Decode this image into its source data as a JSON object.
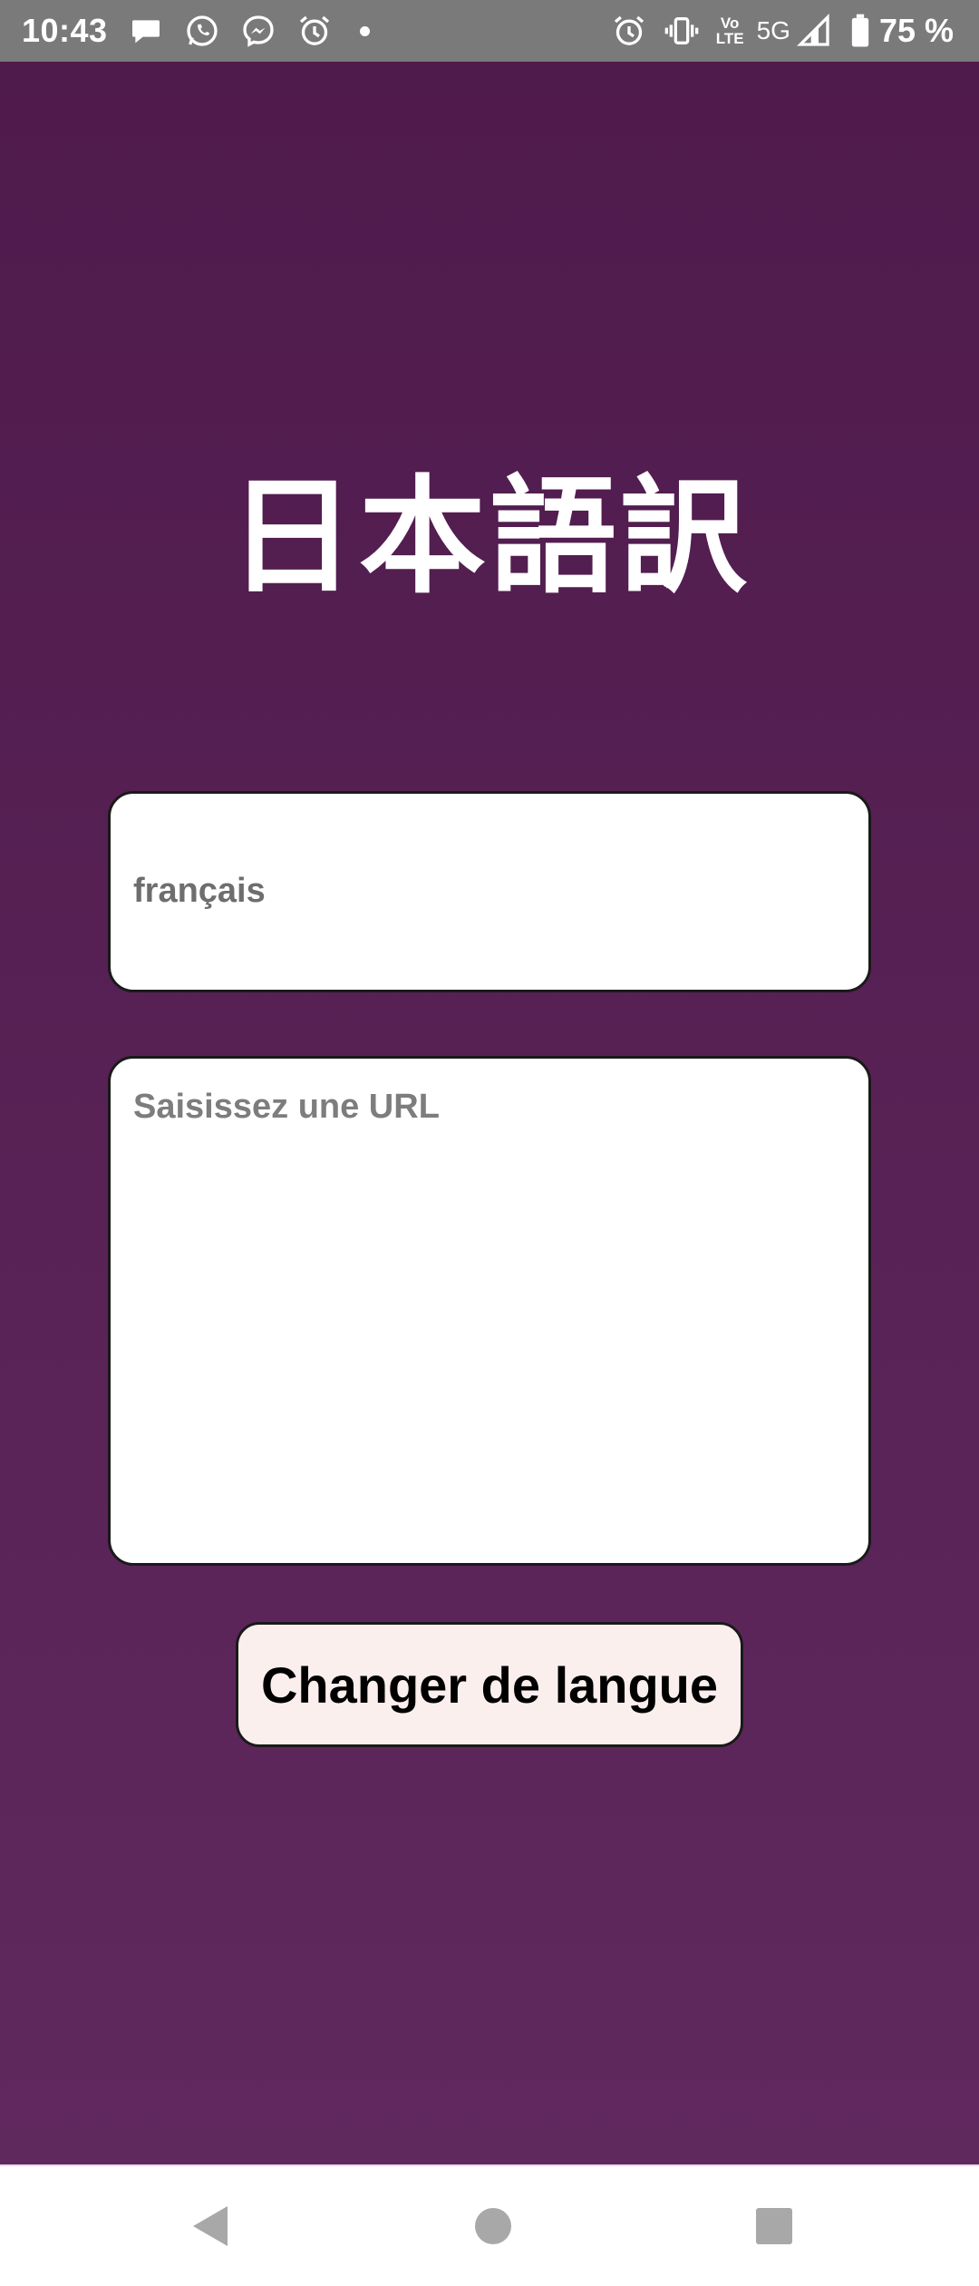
{
  "status_bar": {
    "time": "10:43",
    "left_icons": [
      "chat-bubble-icon",
      "whatsapp-icon",
      "messenger-icon",
      "alarm-clock-icon",
      "dot-icon"
    ],
    "right_icons": [
      "alarm-clock-icon",
      "vibrate-icon",
      "volte-icon",
      "5g-icon",
      "signal-icon",
      "battery-icon"
    ],
    "volte_top": "Vo",
    "volte_bottom": "LTE",
    "network": "5G",
    "battery_percent": "75 %",
    "background_color": "#7a7a7a"
  },
  "app": {
    "title": "日本語訳",
    "language_field": {
      "value": "français"
    },
    "url_field": {
      "placeholder": "Saisissez une URL"
    },
    "change_language_button": {
      "label": "Changer de langue"
    },
    "background_gradient": [
      "#4f1a4c",
      "#60295e"
    ]
  },
  "nav_bar": {
    "buttons": [
      "back-triangle-icon",
      "home-circle-icon",
      "recents-square-icon"
    ],
    "icon_color": "#a8a8a8"
  }
}
